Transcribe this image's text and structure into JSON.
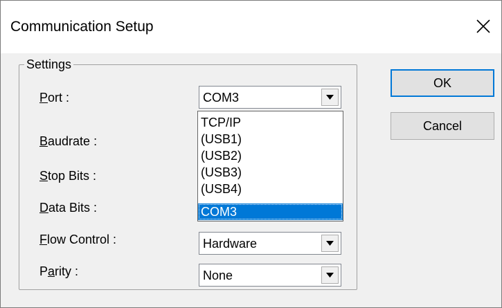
{
  "window": {
    "title": "Communication Setup",
    "close_icon": "close-icon"
  },
  "settings": {
    "group_title": "Settings",
    "fields": {
      "port": {
        "label_first": "P",
        "label_rest": "ort :",
        "value": "COM3"
      },
      "baudrate": {
        "label_first": "B",
        "label_rest": "audrate :"
      },
      "stop_bits": {
        "label_first": "S",
        "label_rest": "top Bits :"
      },
      "data_bits": {
        "label_first": "D",
        "label_rest": "ata Bits :"
      },
      "flow_control": {
        "label_first": "F",
        "label_rest": "low Control :",
        "value": "Hardware"
      },
      "parity": {
        "label_before": "P",
        "label_underlined": "a",
        "label_after": "rity :",
        "value": "None"
      }
    },
    "port_dropdown": {
      "options": [
        "TCP/IP",
        "(USB1)",
        "(USB2)",
        "(USB3)",
        "(USB4)",
        "COM3"
      ],
      "selected": "COM3"
    }
  },
  "buttons": {
    "ok": "OK",
    "cancel": "Cancel"
  },
  "colors": {
    "accent": "#0078d7",
    "selection_text": "#ffffff"
  }
}
